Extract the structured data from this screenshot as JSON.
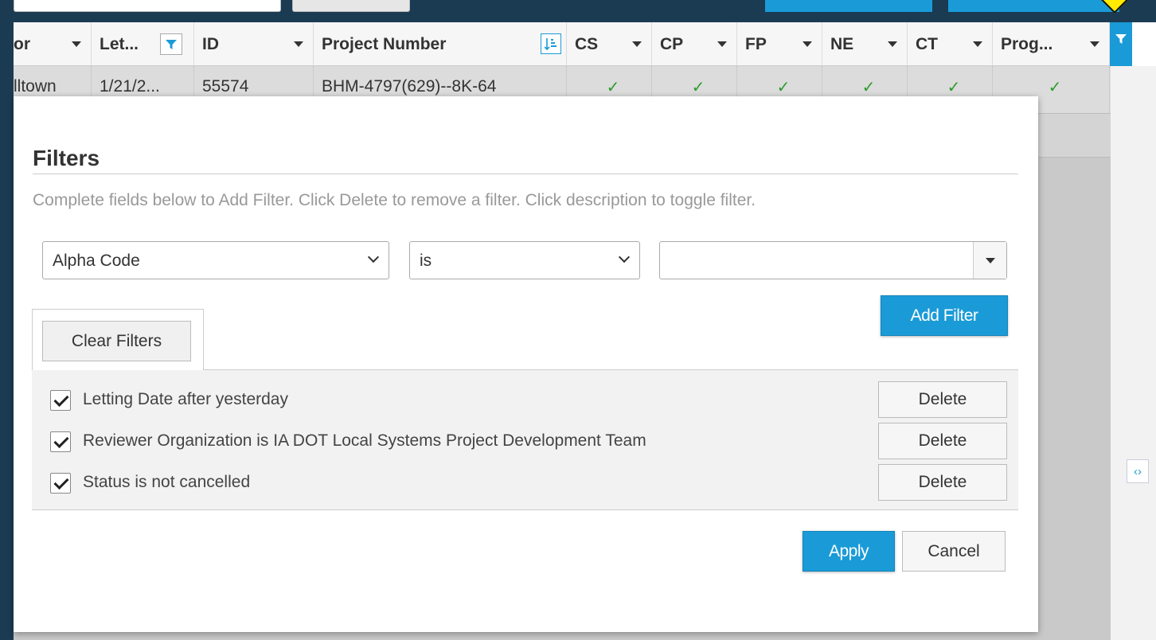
{
  "header": {
    "columns": [
      {
        "label": "or"
      },
      {
        "label": "Let..."
      },
      {
        "label": "ID"
      },
      {
        "label": "Project Number"
      },
      {
        "label": "CS"
      },
      {
        "label": "CP"
      },
      {
        "label": "FP"
      },
      {
        "label": "NE"
      },
      {
        "label": "CT"
      },
      {
        "label": "Prog..."
      }
    ]
  },
  "row": {
    "city": "lltown",
    "date": "1/21/2...",
    "id": "55574",
    "project_number": "BHM-4797(629)--8K-64",
    "check_glyph": "✓"
  },
  "icons": {
    "filter": "filter-icon",
    "sort": "sort-icon",
    "collapse": "collapse-icon",
    "warning": "warning-icon"
  },
  "dialog": {
    "title": "Filters",
    "help_text": "Complete fields below to Add Filter. Click Delete to remove a filter. Click description to toggle filter.",
    "field_select": "Alpha Code",
    "operator_select": "is",
    "value_input": "",
    "add_filter_label": "Add Filter",
    "clear_filters_label": "Clear Filters",
    "filters": [
      {
        "text": "Letting Date after yesterday",
        "checked": true,
        "delete_label": "Delete"
      },
      {
        "text": "Reviewer Organization is IA DOT Local Systems Project Development Team",
        "checked": true,
        "delete_label": "Delete"
      },
      {
        "text": "Status is not cancelled",
        "checked": true,
        "delete_label": "Delete"
      }
    ],
    "apply_label": "Apply",
    "cancel_label": "Cancel"
  },
  "colors": {
    "accent": "#1a9bd7",
    "frame": "#1b3b53",
    "check": "#2e9b2e"
  }
}
